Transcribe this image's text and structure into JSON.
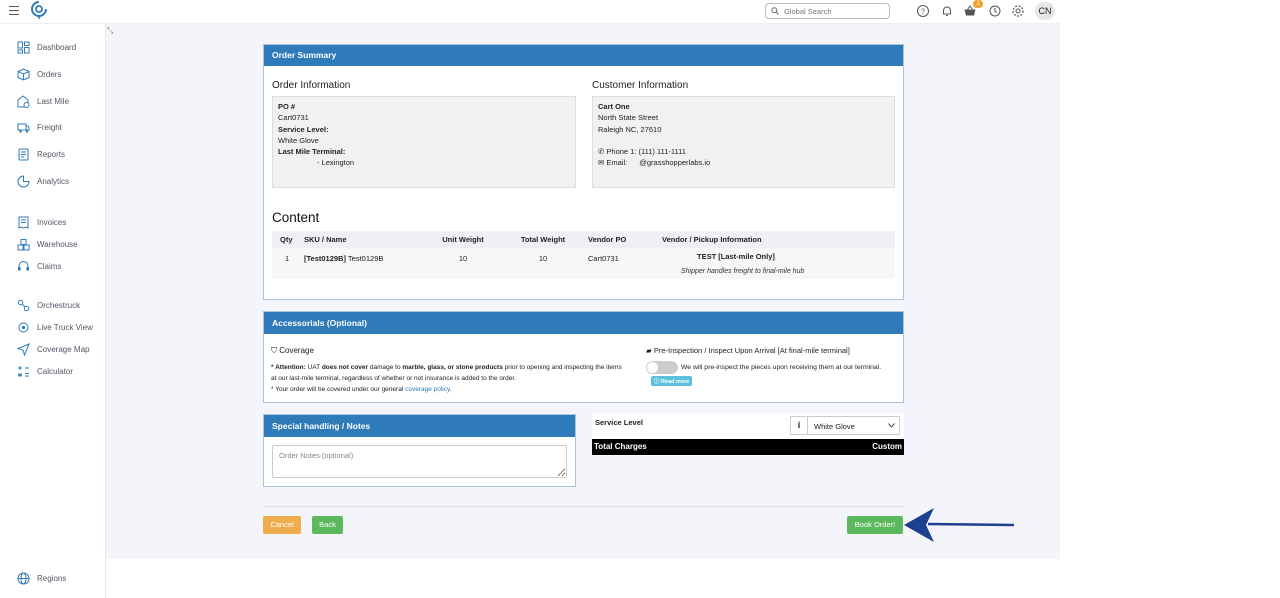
{
  "header": {
    "search_placeholder": "Global Search",
    "cart_badge": "1",
    "avatar_initials": "CN"
  },
  "sidebar": {
    "items": [
      {
        "label": "Dashboard",
        "icon": "dashboard-icon"
      },
      {
        "label": "Orders",
        "icon": "box-icon"
      },
      {
        "label": "Last Mile",
        "icon": "last-mile-icon"
      },
      {
        "label": "Freight",
        "icon": "truck-icon"
      },
      {
        "label": "Reports",
        "icon": "reports-icon"
      },
      {
        "label": "Analytics",
        "icon": "analytics-icon"
      },
      {
        "label": "Invoices",
        "icon": "invoice-icon"
      },
      {
        "label": "Warehouse",
        "icon": "warehouse-icon"
      },
      {
        "label": "Claims",
        "icon": "headset-icon"
      },
      {
        "label": "Orchestruck",
        "icon": "orchestruck-icon"
      },
      {
        "label": "Live Truck View",
        "icon": "live-view-icon"
      },
      {
        "label": "Coverage Map",
        "icon": "navigation-icon"
      },
      {
        "label": "Calculator",
        "icon": "calculator-icon"
      }
    ],
    "regions_label": "Regions"
  },
  "order_summary": {
    "header": "Order Summary",
    "order_info": {
      "title": "Order Information",
      "po_label": "PO #",
      "po_value": "Cart0731",
      "service_label": "Service Level:",
      "service_value": "White Glove",
      "terminal_label": "Last Mile Terminal:",
      "terminal_value": "- Lexington"
    },
    "customer_info": {
      "title": "Customer Information",
      "name": "Cart One",
      "street": "North State Street",
      "city": "Raleigh NC, 27610",
      "phone": "Phone 1: (111) 111-1111",
      "email_label": "Email:",
      "email_value": "@grasshopperlabs.io"
    },
    "content": {
      "title": "Content",
      "columns": [
        "Qty",
        "SKU / Name",
        "Unit Weight",
        "Total Weight",
        "Vendor PO",
        "Vendor / Pickup Information"
      ],
      "row": {
        "qty": "1",
        "sku_bold": "[Test0129B]",
        "sku_name": "Test0129B",
        "unit_weight": "10",
        "total_weight": "10",
        "vendor_po": "Cart0731",
        "vendor_info": "TEST [Last-mile Only]",
        "vendor_note": "Shipper handles freight to final-mile hub"
      }
    }
  },
  "accessorials": {
    "header": "Accessorials (Optional)",
    "coverage_title": "Coverage",
    "attention_label": "* Attention:",
    "attention_pre": "UAT",
    "attention_bold1": "does not cover",
    "attention_mid": "damage to",
    "attention_bold2": "marble, glass, or stone products",
    "attention_post": "prior to opening and inspecting the items",
    "attention_line2": "at our last-mile terminal, regardless of whether or not insurance is added to the order.",
    "policy_pre": "* Your order will be covered under our general",
    "policy_link": "coverage policy",
    "policy_post": ".",
    "inspection_title": "Pre-Inspection / Inspect Upon Arrival [At final-mile terminal]",
    "inspection_desc": "We will pre-inspect the pieces upon receiving them at our terminal.",
    "read_more": "Read more"
  },
  "notes": {
    "header": "Special handling / Notes",
    "placeholder": "Order Notes (optional)"
  },
  "service_level": {
    "label": "Service Level",
    "selected": "White Glove",
    "total_label": "Total Charges",
    "total_value": "Custom"
  },
  "actions": {
    "cancel": "Cancel",
    "back": "Back",
    "book": "Book Order!"
  },
  "colors": {
    "primary": "#2f7ab8",
    "cancel": "#f0ad4e",
    "success": "#5cb85c",
    "arrow": "#1f3f8f"
  }
}
